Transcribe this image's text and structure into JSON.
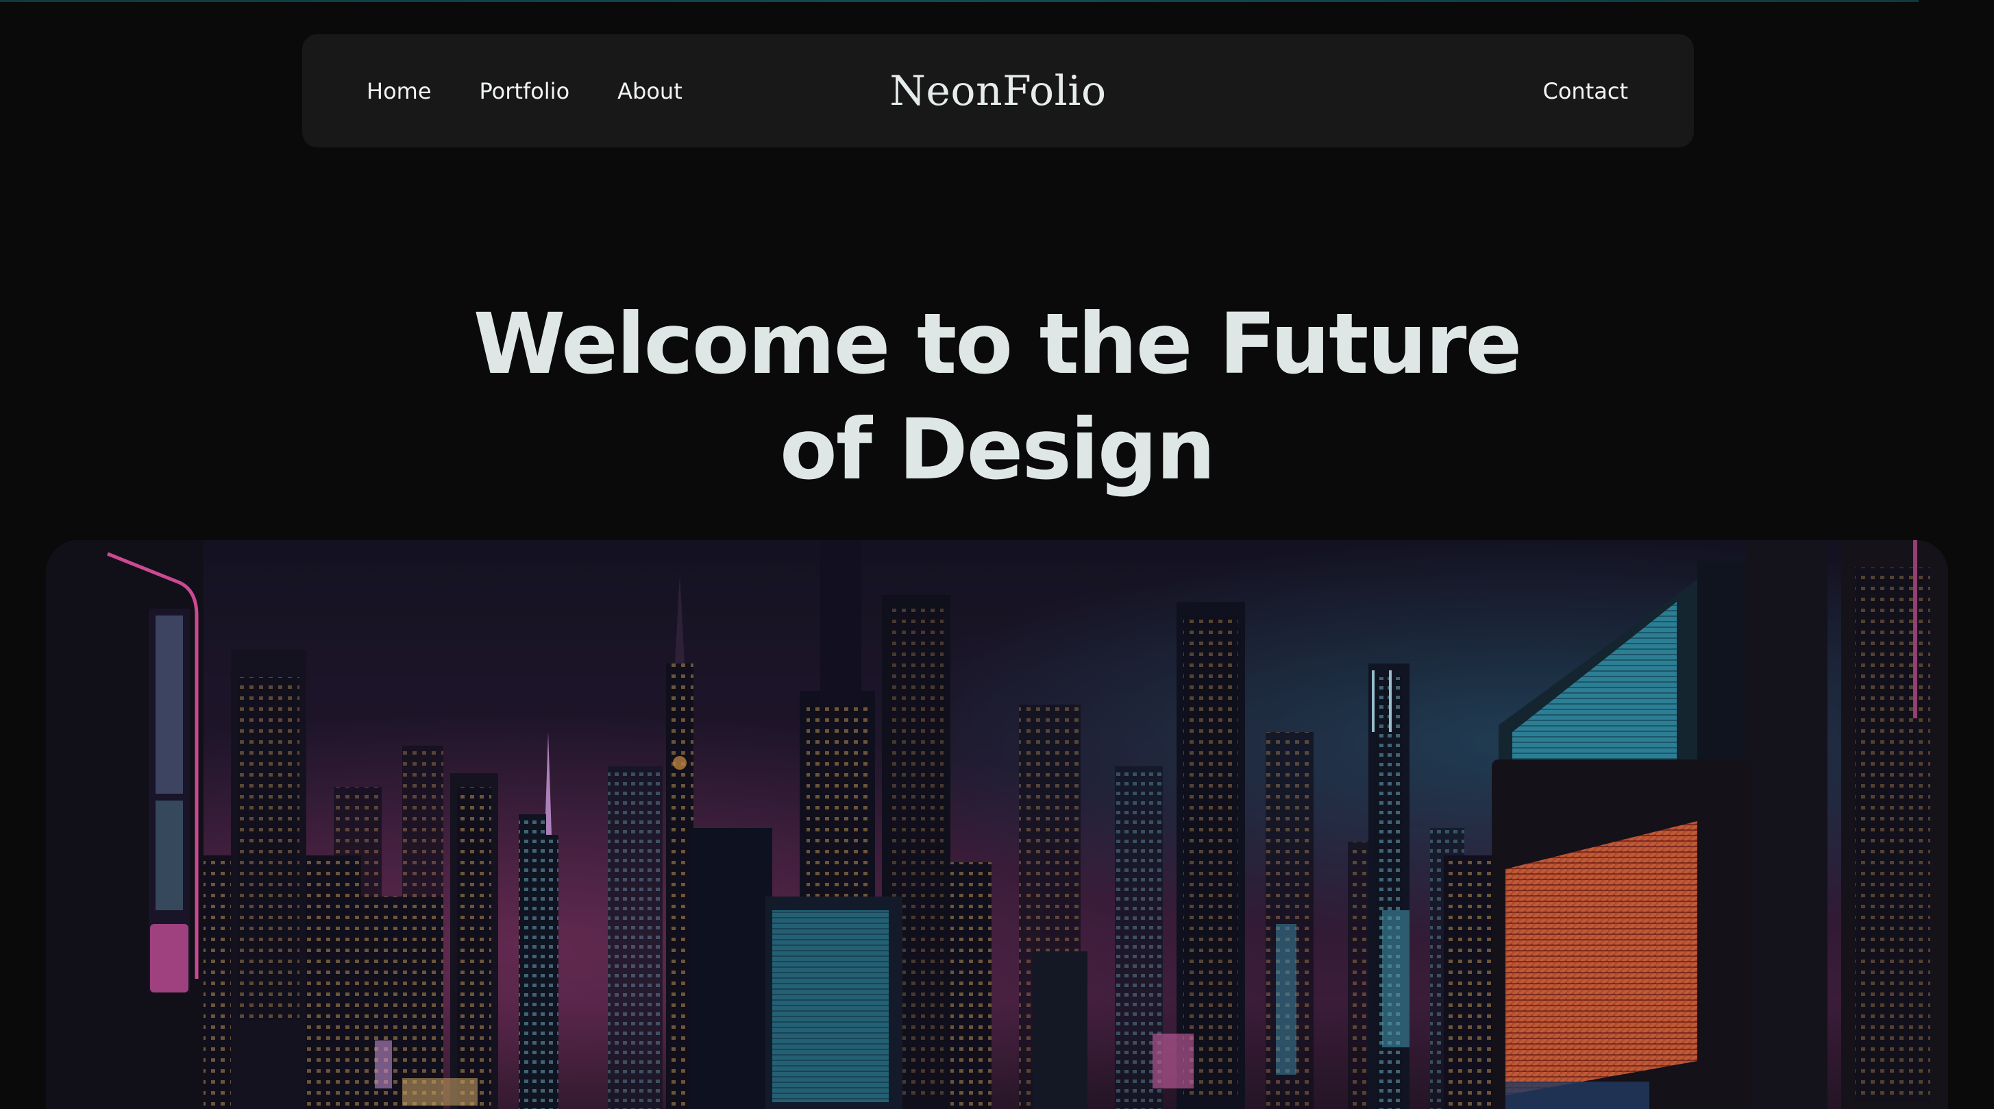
{
  "nav": {
    "links": [
      "Home",
      "Portfolio",
      "About"
    ],
    "brand": "NeonFolio",
    "contact": "Contact"
  },
  "hero": {
    "title_line1": "Welcome to the Future",
    "title_line2": "of Design"
  },
  "image": {
    "subject": "neon-city-skyline-icon"
  },
  "colors": {
    "background": "#0a0a0a",
    "navbar": "#181818",
    "heading": "#dfe7e6",
    "neon_pink": "#ff4fb0",
    "neon_cyan": "#3fd6f0"
  }
}
